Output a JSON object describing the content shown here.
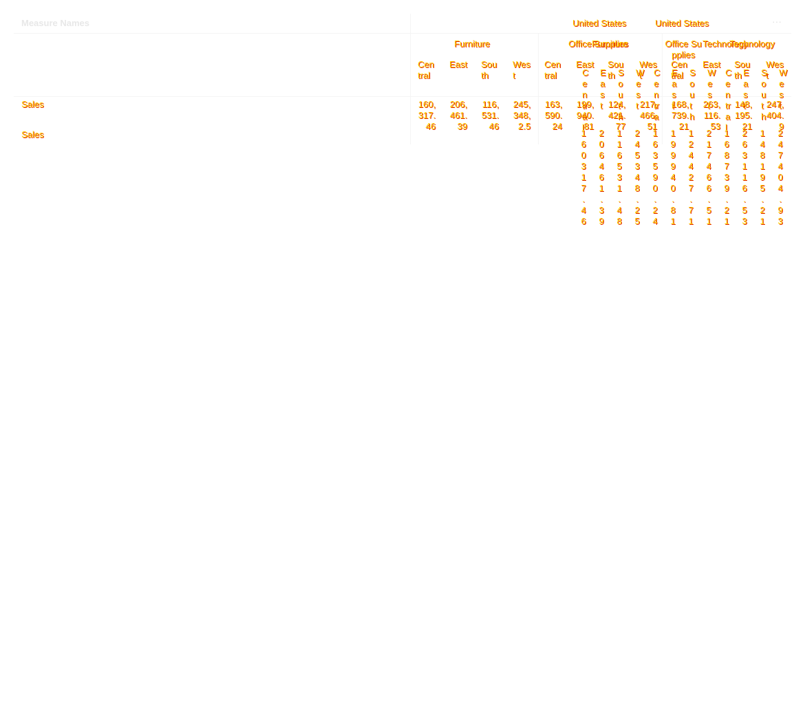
{
  "header": {
    "measure_names": "Measure Names",
    "more_icon": "ellipsis-icon",
    "more_glyph": "···"
  },
  "columns": {
    "country_1": "United States",
    "country_2": "United States",
    "categories": [
      "Furniture",
      "Office Supplies",
      "Furniture",
      "Office Supplies",
      "Technology",
      "Technology"
    ],
    "regions_main": [
      "Central",
      "East",
      "South",
      "West",
      "Central",
      "East",
      "South",
      "West",
      "Central",
      "East",
      "South",
      "West"
    ],
    "regions_narrow": [
      "Central",
      "East",
      "South",
      "West",
      "Central",
      "East",
      "South",
      "West",
      "Central",
      "East",
      "South",
      "West"
    ]
  },
  "rows": {
    "sales_label_1": "Sales",
    "sales_label_2": "Sales",
    "sales_main": [
      "160,317.46",
      "206,461.39",
      "116,531.46",
      "245,348,2.5",
      "163,590.24",
      "199,940.81",
      "124,421.77",
      "217,466.51",
      "168,739.21",
      "263,116.53",
      "148,195.21",
      "247,404.9"
    ],
    "sales_narrow": [
      "160317.46",
      "206461.39",
      "116531.48",
      "245348.25",
      "163590.24",
      "199940.81",
      "124427.71",
      "217466.51",
      "168739.21",
      "263116.53",
      "148195.21",
      "247404.93"
    ]
  },
  "colors": {
    "text_fill": "#ffd400",
    "text_outline": "#e02000",
    "header_faint": "#e8e8e8"
  }
}
